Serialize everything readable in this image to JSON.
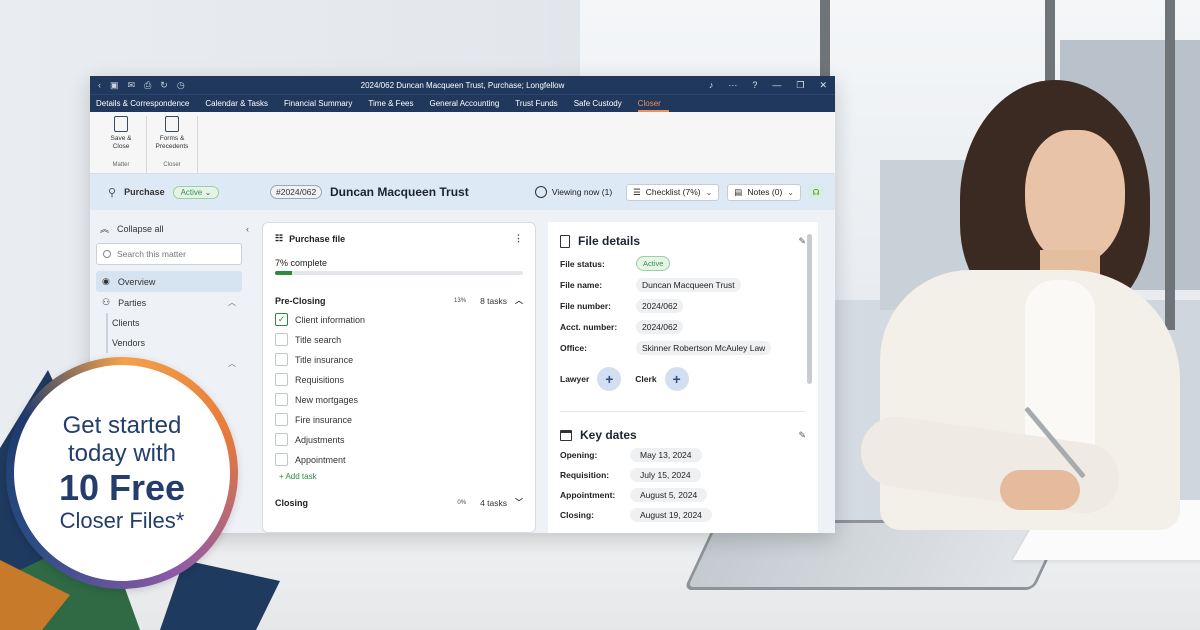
{
  "app": {
    "title": "2024/062 Duncan Macqueen Trust, Purchase; Longfellow",
    "menu": [
      "Details & Correspondence",
      "Calendar & Tasks",
      "Financial Summary",
      "Time & Fees",
      "General Accounting",
      "Trust Funds",
      "Safe Custody",
      "Closer"
    ],
    "active_menu": "Closer",
    "ribbon": {
      "save_close": "Save & Close",
      "forms_precedents": "Forms & Precedents",
      "group_matter": "Matter",
      "group_closer": "Closer"
    }
  },
  "matter": {
    "type": "Purchase",
    "status": "Active",
    "number": "#2024/062",
    "name": "Duncan Macqueen Trust",
    "viewing_now": "Viewing now (1)",
    "checklist": "Checklist (7%)",
    "notes": "Notes (0)"
  },
  "sidebar": {
    "collapse_all": "Collapse all",
    "search_placeholder": "Search this matter",
    "items": {
      "overview": "Overview",
      "parties": "Parties",
      "clients": "Clients",
      "vendors": "Vendors"
    }
  },
  "purchase_file": {
    "title": "Purchase file",
    "progress_label": "7% complete",
    "progress_fraction": 0.07,
    "sections": [
      {
        "name": "Pre-Closing",
        "pct": "13%",
        "tasks_label": "8 tasks",
        "tasks": [
          {
            "label": "Client information",
            "checked": true
          },
          {
            "label": "Title search",
            "checked": false
          },
          {
            "label": "Title insurance",
            "checked": false
          },
          {
            "label": "Requisitions",
            "checked": false
          },
          {
            "label": "New mortgages",
            "checked": false
          },
          {
            "label": "Fire insurance",
            "checked": false
          },
          {
            "label": "Adjustments",
            "checked": false
          },
          {
            "label": "Appointment",
            "checked": false
          }
        ],
        "add_task": "+ Add task"
      },
      {
        "name": "Closing",
        "pct": "0%",
        "tasks_label": "4 tasks"
      }
    ]
  },
  "file_details": {
    "title": "File details",
    "fields": [
      {
        "label": "File status:",
        "value": "Active"
      },
      {
        "label": "File name:",
        "value": "Duncan Macqueen Trust"
      },
      {
        "label": "File number:",
        "value": "2024/062"
      },
      {
        "label": "Acct. number:",
        "value": "2024/062"
      },
      {
        "label": "Office:",
        "value": "Skinner Robertson McAuley Law"
      }
    ],
    "lawyer": "Lawyer",
    "clerk": "Clerk"
  },
  "key_dates": {
    "title": "Key dates",
    "dates": [
      {
        "label": "Opening:",
        "value": "May 13, 2024"
      },
      {
        "label": "Requisition:",
        "value": "July 15, 2024"
      },
      {
        "label": "Appointment:",
        "value": "August 5, 2024"
      },
      {
        "label": "Closing:",
        "value": "August 19, 2024"
      }
    ]
  },
  "promo": {
    "line1": "Get started",
    "line2": "today with",
    "line3": "10 Free",
    "line4": "Closer Files*"
  }
}
